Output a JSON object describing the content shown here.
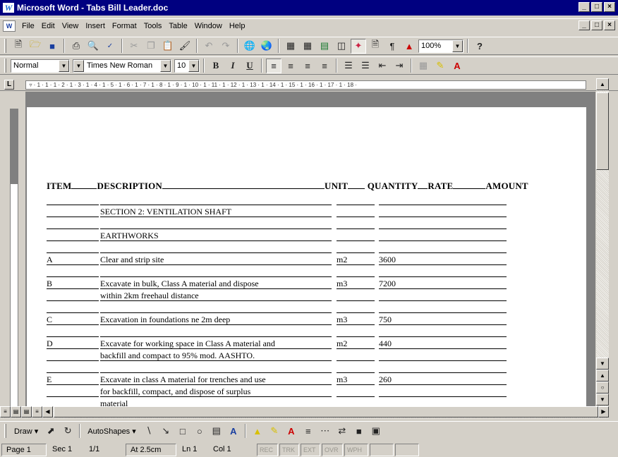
{
  "window": {
    "app_icon": "W",
    "title": "Microsoft Word - Tabs Bill Leader.doc",
    "controls": [
      "_",
      "□",
      "×"
    ]
  },
  "menubar": {
    "items": [
      "File",
      "Edit",
      "View",
      "Insert",
      "Format",
      "Tools",
      "Table",
      "Window",
      "Help"
    ]
  },
  "standard_toolbar": {
    "icons": [
      "new-document-icon",
      "open-folder-icon",
      "save-icon",
      "print-icon",
      "print-preview-icon",
      "spelling-icon",
      "cut-icon",
      "copy-icon",
      "paste-icon",
      "format-painter-icon",
      "undo-icon",
      "redo-icon",
      "hyperlink-icon",
      "web-toolbar-icon",
      "tables-borders-icon",
      "insert-table-icon",
      "insert-excel-icon",
      "columns-icon",
      "drawing-icon",
      "document-map-icon",
      "show-hide-icon",
      "acrobat-icon",
      "help-icon"
    ],
    "zoom": "100%"
  },
  "formatting_toolbar": {
    "style": "Normal",
    "font": "Times New Roman",
    "size": "10",
    "bold": "B",
    "italic": "I",
    "underline": "U"
  },
  "document": {
    "header": {
      "item": "ITEM",
      "description": "DESCRIPTION",
      "unit": "UNIT",
      "quantity": "QUANTITY",
      "rate": "RATE",
      "amount": "AMOUNT"
    },
    "rows": [
      {
        "item": "",
        "desc": "",
        "unit": "",
        "qty": ""
      },
      {
        "item": "",
        "desc": "SECTION 2: VENTILATION SHAFT",
        "unit": "",
        "qty": ""
      },
      {
        "item": "",
        "desc": "",
        "unit": "",
        "qty": ""
      },
      {
        "item": "",
        "desc": "EARTHWORKS",
        "unit": "",
        "qty": ""
      },
      {
        "item": "",
        "desc": "",
        "unit": "",
        "qty": ""
      },
      {
        "item": "A",
        "desc": "Clear and strip site",
        "unit": "m2",
        "qty": "3600"
      },
      {
        "item": "",
        "desc": "",
        "unit": "",
        "qty": ""
      },
      {
        "item": "B",
        "desc": "Excavate in bulk, Class A material and dispose",
        "unit": "m3",
        "qty": "7200"
      },
      {
        "item": "",
        "desc": "  within 2km freehaul distance",
        "unit": "",
        "qty": ""
      },
      {
        "item": "",
        "desc": "",
        "unit": "",
        "qty": ""
      },
      {
        "item": "C",
        "desc": "Excavation in foundations ne 2m deep",
        "unit": "m3",
        "qty": "750"
      },
      {
        "item": "",
        "desc": "",
        "unit": "",
        "qty": ""
      },
      {
        "item": "D",
        "desc": "Excavate for working space in Class A material and",
        "unit": "m2",
        "qty": "440"
      },
      {
        "item": "",
        "desc": "backfill and compact to 95% mod. AASHTO.",
        "unit": "",
        "qty": ""
      },
      {
        "item": "",
        "desc": "",
        "unit": "",
        "qty": ""
      },
      {
        "item": "E",
        "desc": "Excavate in class A material for trenches and use",
        "unit": "m3",
        "qty": "260"
      },
      {
        "item": "",
        "desc": "  for backfill, compact, and dispose of surplus",
        "unit": "",
        "qty": ""
      },
      {
        "item": "",
        "desc": "  material",
        "unit": "",
        "qty": ""
      }
    ]
  },
  "drawing_toolbar": {
    "draw": "Draw",
    "autoshapes": "AutoShapes"
  },
  "statusbar": {
    "page": "Page 1",
    "section": "Sec 1",
    "pages": "1/1",
    "at": "At 2.5cm",
    "line": "Ln 1",
    "col": "Col 1",
    "rec": "REC",
    "trk": "TRK",
    "ext": "EXT",
    "ovr": "OVR",
    "wph": "WPH"
  }
}
